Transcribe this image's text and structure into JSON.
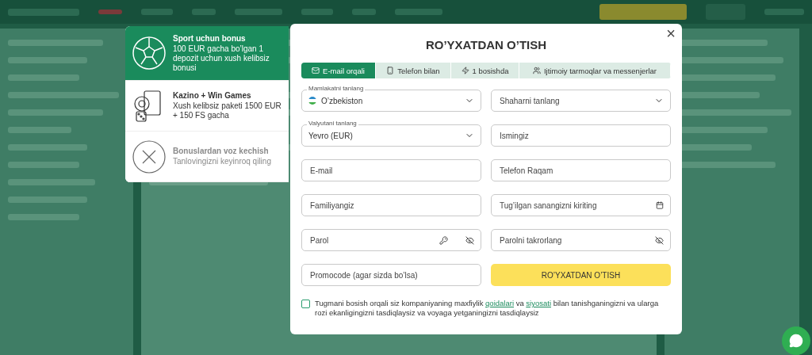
{
  "bonuses": [
    {
      "kind": "sport",
      "selected": true,
      "title": "Sport uchun bonus",
      "text": "100 EUR gacha bo’lgan 1 depozit uchun xush kelibsiz bonusi"
    },
    {
      "kind": "casino",
      "selected": false,
      "title": "Kazino + Win Games",
      "text": "Xush kelibsiz paketi 1500 EUR + 150 FS gacha"
    },
    {
      "kind": "decline",
      "selected": false,
      "title": "Bonuslardan voz kechish",
      "text": "Tanlovingizni keyinroq qiling"
    }
  ],
  "modal": {
    "title": "RO’YXATDAN O’TISH",
    "close": "×",
    "tabs": [
      {
        "kind": "mail",
        "label": "E-mail orqali",
        "selected": true
      },
      {
        "kind": "phone",
        "label": "Telefon bilan",
        "selected": false
      },
      {
        "kind": "bolt",
        "label": "1 bosishda",
        "selected": false
      },
      {
        "kind": "people",
        "label": "Ijtimoiy tarmoqlar va messenjerlar",
        "selected": false
      }
    ],
    "fields": [
      {
        "kind": "select",
        "label": "Mamlakatni tanlang",
        "value": "O’zbekiston",
        "flag": true
      },
      {
        "kind": "select",
        "placeholder": "Shaharni tanlang"
      },
      {
        "kind": "select",
        "label": "Valyutani tanlang",
        "value": "Yevro (EUR)"
      },
      {
        "kind": "input",
        "placeholder": "Ismingiz"
      },
      {
        "kind": "input",
        "placeholder": "E-mail"
      },
      {
        "kind": "input",
        "placeholder": "Telefon Raqam"
      },
      {
        "kind": "input",
        "placeholder": "Familiyangiz"
      },
      {
        "kind": "date",
        "placeholder": "Tug’ilgan sanangizni kiriting"
      },
      {
        "kind": "password",
        "placeholder": "Parol",
        "generate": true
      },
      {
        "kind": "password",
        "placeholder": "Parolni takrorlang",
        "generate": false
      },
      {
        "kind": "input",
        "placeholder": "Promocode (agar sizda bo’lsa)"
      }
    ],
    "submit": "RO’YXATDAN O’TISH",
    "consent": {
      "checked": false,
      "segments": [
        {
          "kind": "text",
          "text": "Tugmani bosish orqali siz kompaniyaning maxfiylik "
        },
        {
          "kind": "link",
          "text": "qoidalari"
        },
        {
          "kind": "text",
          "text": " va "
        },
        {
          "kind": "link",
          "text": "siyosati"
        },
        {
          "kind": "text",
          "text": " bilan tanishganingizni va ularga rozi ekanligingizni tasdiqlaysiz va voyaga yetganingizni tasdiqlaysiz"
        }
      ]
    }
  }
}
